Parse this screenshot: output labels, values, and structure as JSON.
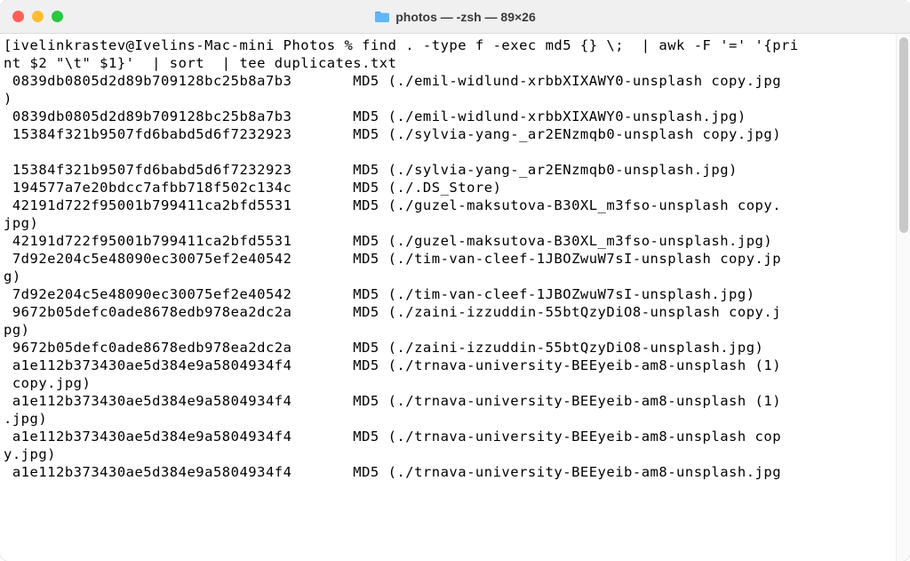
{
  "window": {
    "title": "photos — -zsh — 89×26"
  },
  "prompt": {
    "user": "ivelinkrastev",
    "host": "Ivelins-Mac-mini",
    "dir": "Photos",
    "sep": "%",
    "command_line1": "find . -type f -exec md5 {} \\;  | awk -F '=' '{pri",
    "command_line2": "nt $2 \"\\t\" $1}'  | sort  | tee duplicates.txt"
  },
  "cols": 89,
  "rows": [
    {
      "hash": "0839db0805d2d89b709128bc25b8a7b3",
      "tail": "MD5 (./emil-widlund-xrbbXIXAWY0-unsplash copy.jpg"
    },
    {
      "cont": ")"
    },
    {
      "hash": "0839db0805d2d89b709128bc25b8a7b3",
      "tail": "MD5 (./emil-widlund-xrbbXIXAWY0-unsplash.jpg)"
    },
    {
      "hash": "15384f321b9507fd6babd5d6f7232923",
      "tail": "MD5 (./sylvia-yang-_ar2ENzmqb0-unsplash copy.jpg)"
    },
    {
      "cont": ""
    },
    {
      "hash": "15384f321b9507fd6babd5d6f7232923",
      "tail": "MD5 (./sylvia-yang-_ar2ENzmqb0-unsplash.jpg)"
    },
    {
      "hash": "194577a7e20bdcc7afbb718f502c134c",
      "tail": "MD5 (./.DS_Store)"
    },
    {
      "hash": "42191d722f95001b799411ca2bfd5531",
      "tail": "MD5 (./guzel-maksutova-B30XL_m3fso-unsplash copy."
    },
    {
      "cont": "jpg)"
    },
    {
      "hash": "42191d722f95001b799411ca2bfd5531",
      "tail": "MD5 (./guzel-maksutova-B30XL_m3fso-unsplash.jpg)"
    },
    {
      "hash": "7d92e204c5e48090ec30075ef2e40542",
      "tail": "MD5 (./tim-van-cleef-1JBOZwuW7sI-unsplash copy.jp"
    },
    {
      "cont": "g)"
    },
    {
      "hash": "7d92e204c5e48090ec30075ef2e40542",
      "tail": "MD5 (./tim-van-cleef-1JBOZwuW7sI-unsplash.jpg)"
    },
    {
      "hash": "9672b05defc0ade8678edb978ea2dc2a",
      "tail": "MD5 (./zaini-izzuddin-55btQzyDiO8-unsplash copy.j"
    },
    {
      "cont": "pg)"
    },
    {
      "hash": "9672b05defc0ade8678edb978ea2dc2a",
      "tail": "MD5 (./zaini-izzuddin-55btQzyDiO8-unsplash.jpg)"
    },
    {
      "hash": "a1e112b373430ae5d384e9a5804934f4",
      "tail": "MD5 (./trnava-university-BEEyeib-am8-unsplash (1)"
    },
    {
      "cont": " copy.jpg)"
    },
    {
      "hash": "a1e112b373430ae5d384e9a5804934f4",
      "tail": "MD5 (./trnava-university-BEEyeib-am8-unsplash (1)"
    },
    {
      "cont": ".jpg)"
    },
    {
      "hash": "a1e112b373430ae5d384e9a5804934f4",
      "tail": "MD5 (./trnava-university-BEEyeib-am8-unsplash cop"
    },
    {
      "cont": "y.jpg)"
    },
    {
      "hash": "a1e112b373430ae5d384e9a5804934f4",
      "tail": "MD5 (./trnava-university-BEEyeib-am8-unsplash.jpg"
    }
  ]
}
